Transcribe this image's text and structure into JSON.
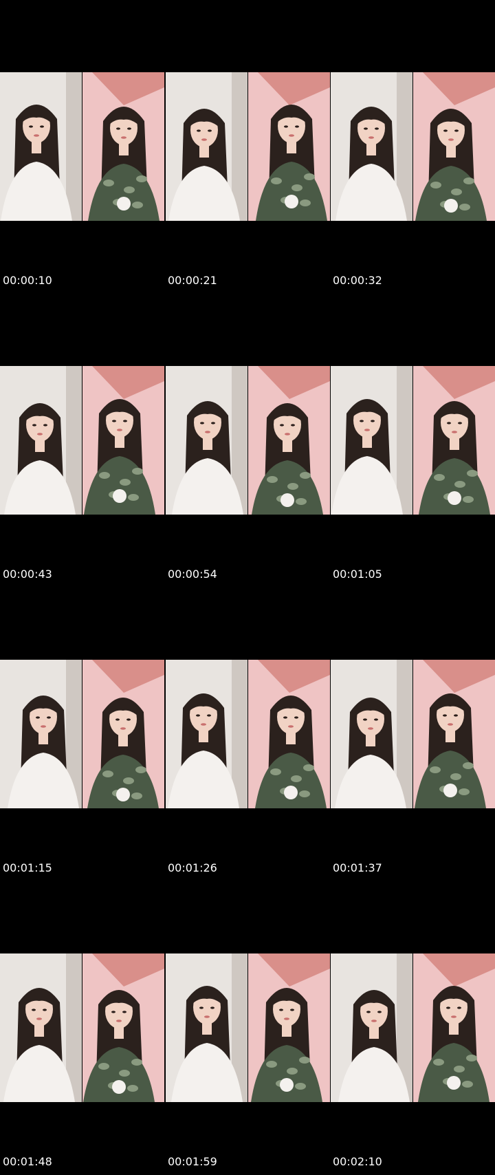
{
  "contact_sheet": {
    "rows": [
      {
        "timestamps": [
          "00:00:10",
          "00:00:21",
          "00:00:32"
        ],
        "frames": [
          {
            "scene": "light-wall",
            "shirt": "white"
          },
          {
            "scene": "pink-wall",
            "shirt": "camo"
          },
          {
            "scene": "light-wall",
            "shirt": "white"
          },
          {
            "scene": "pink-wall",
            "shirt": "camo"
          },
          {
            "scene": "light-wall",
            "shirt": "white"
          },
          {
            "scene": "pink-wall",
            "shirt": "camo"
          }
        ]
      },
      {
        "timestamps": [
          "00:00:43",
          "00:00:54",
          "00:01:05"
        ],
        "frames": [
          {
            "scene": "light-wall",
            "shirt": "white"
          },
          {
            "scene": "pink-wall",
            "shirt": "camo"
          },
          {
            "scene": "light-wall",
            "shirt": "white"
          },
          {
            "scene": "pink-wall",
            "shirt": "camo"
          },
          {
            "scene": "light-wall",
            "shirt": "white"
          },
          {
            "scene": "pink-wall",
            "shirt": "camo"
          }
        ]
      },
      {
        "timestamps": [
          "00:01:15",
          "00:01:26",
          "00:01:37"
        ],
        "frames": [
          {
            "scene": "light-wall",
            "shirt": "white"
          },
          {
            "scene": "pink-wall",
            "shirt": "camo"
          },
          {
            "scene": "light-wall",
            "shirt": "white"
          },
          {
            "scene": "pink-wall",
            "shirt": "camo"
          },
          {
            "scene": "light-wall",
            "shirt": "white"
          },
          {
            "scene": "pink-wall",
            "shirt": "camo"
          }
        ]
      },
      {
        "timestamps": [
          "00:01:48",
          "00:01:59",
          "00:02:10"
        ],
        "frames": [
          {
            "scene": "light-wall",
            "shirt": "white"
          },
          {
            "scene": "pink-wall",
            "shirt": "camo"
          },
          {
            "scene": "light-wall",
            "shirt": "white"
          },
          {
            "scene": "pink-wall",
            "shirt": "camo"
          },
          {
            "scene": "light-wall",
            "shirt": "white"
          },
          {
            "scene": "pink-wall",
            "shirt": "camo"
          }
        ]
      }
    ],
    "colors": {
      "background": "#000000",
      "timestamp_text": "#ffffff",
      "light_wall": "#e8e4e0",
      "pink_wall": "#efc4c4",
      "pink_ceiling": "#d98f8a",
      "skin": "#f1d3c4",
      "hair": "#2b211d",
      "white_shirt": "#f4f1ee",
      "camo_base": "#4a5a46",
      "camo_spot": "#8a9a80"
    }
  }
}
